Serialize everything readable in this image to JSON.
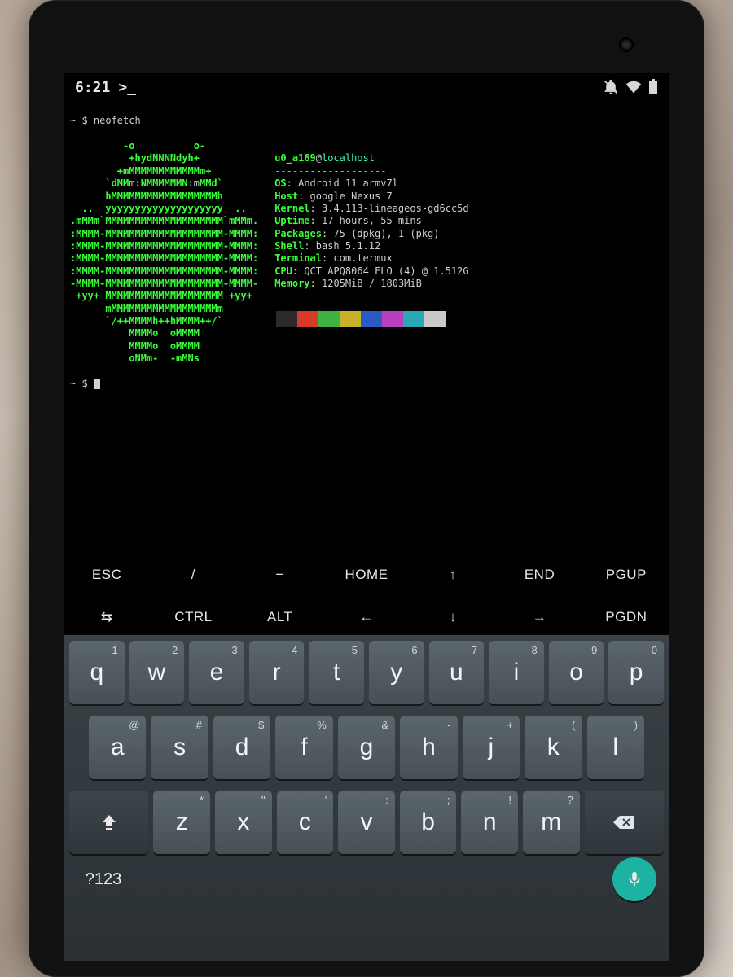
{
  "statusbar": {
    "time": "6:21",
    "prompt_glyph": ">_"
  },
  "term": {
    "prompt_line": "~ $ neofetch",
    "prompt2": "~ $ ",
    "user": "u0_a169",
    "at": "@",
    "host": "localhost",
    "dash": "-------------------",
    "info": [
      {
        "k": "OS",
        "v": "Android 11 armv7l"
      },
      {
        "k": "Host",
        "v": "google Nexus 7"
      },
      {
        "k": "Kernel",
        "v": "3.4.113-lineageos-gd6cc5d"
      },
      {
        "k": "Uptime",
        "v": "17 hours, 55 mins"
      },
      {
        "k": "Packages",
        "v": "75 (dpkg), 1 (pkg)"
      },
      {
        "k": "Shell",
        "v": "bash 5.1.12"
      },
      {
        "k": "Terminal",
        "v": "com.termux"
      },
      {
        "k": "CPU",
        "v": "QCT APQ8064 FLO (4) @ 1.512G"
      },
      {
        "k": "Memory",
        "v": "1205MiB / 1803MiB"
      }
    ],
    "palette": [
      "#2b2b2b",
      "#d43b2a",
      "#3fb23f",
      "#c7b32a",
      "#2d59c7",
      "#b83fbf",
      "#2aa7b8",
      "#c9c9c9"
    ],
    "ascii": [
      "         -o          o-",
      "          +hydNNNNdyh+",
      "        +mMMMMMMMMMMMMm+",
      "      `dMM|m|:NMMMMMMN:|m|MMd`",
      "      hMMMMMMMMMMMMMMMMMMh",
      "  ..  yyyyyyyyyyyyyyyyyyyy  ..",
      ".mMMm`MMMMMMMMMMMMMMMMMMMM`mMMm.",
      ":MMMM-MMMMMMMMMMMMMMMMMMMM-MMMM:",
      ":MMMM-MMMMMMMMMMMMMMMMMMMM-MMMM:",
      ":MMMM-MMMMMMMMMMMMMMMMMMMM-MMMM:",
      ":MMMM-MMMMMMMMMMMMMMMMMMMM-MMMM:",
      "-MMMM-MMMMMMMMMMMMMMMMMMMM-MMMM-",
      " +yy+ MMMMMMMMMMMMMMMMMMMM +yy+",
      "      mMMMMMMMMMMMMMMMMMMm",
      "      `/++MMMMh++hMMMM++/`",
      "          MMMMo  oMMMM",
      "          MMMMo  oMMMM",
      "          oNMm-  -mMNs"
    ]
  },
  "extra": {
    "row1": [
      "ESC",
      "/",
      "−",
      "HOME",
      "↑",
      "END",
      "PGUP"
    ],
    "row2": [
      "⇆",
      "CTRL",
      "ALT",
      "←",
      "↓",
      "→",
      "PGDN"
    ]
  },
  "kb": {
    "row1": [
      {
        "m": "q",
        "s": "1"
      },
      {
        "m": "w",
        "s": "2"
      },
      {
        "m": "e",
        "s": "3"
      },
      {
        "m": "r",
        "s": "4"
      },
      {
        "m": "t",
        "s": "5"
      },
      {
        "m": "y",
        "s": "6"
      },
      {
        "m": "u",
        "s": "7"
      },
      {
        "m": "i",
        "s": "8"
      },
      {
        "m": "o",
        "s": "9"
      },
      {
        "m": "p",
        "s": "0"
      }
    ],
    "row2": [
      {
        "m": "a",
        "s": "@"
      },
      {
        "m": "s",
        "s": "#"
      },
      {
        "m": "d",
        "s": "$"
      },
      {
        "m": "f",
        "s": "%"
      },
      {
        "m": "g",
        "s": "&"
      },
      {
        "m": "h",
        "s": "-"
      },
      {
        "m": "j",
        "s": "+"
      },
      {
        "m": "k",
        "s": "("
      },
      {
        "m": "l",
        "s": ")"
      }
    ],
    "row3": [
      {
        "m": "z",
        "s": "*"
      },
      {
        "m": "x",
        "s": "\""
      },
      {
        "m": "c",
        "s": "'"
      },
      {
        "m": "v",
        "s": ":"
      },
      {
        "m": "b",
        "s": ";"
      },
      {
        "m": "n",
        "s": "!"
      },
      {
        "m": "m",
        "s": "?"
      }
    ],
    "sym": "?123"
  }
}
